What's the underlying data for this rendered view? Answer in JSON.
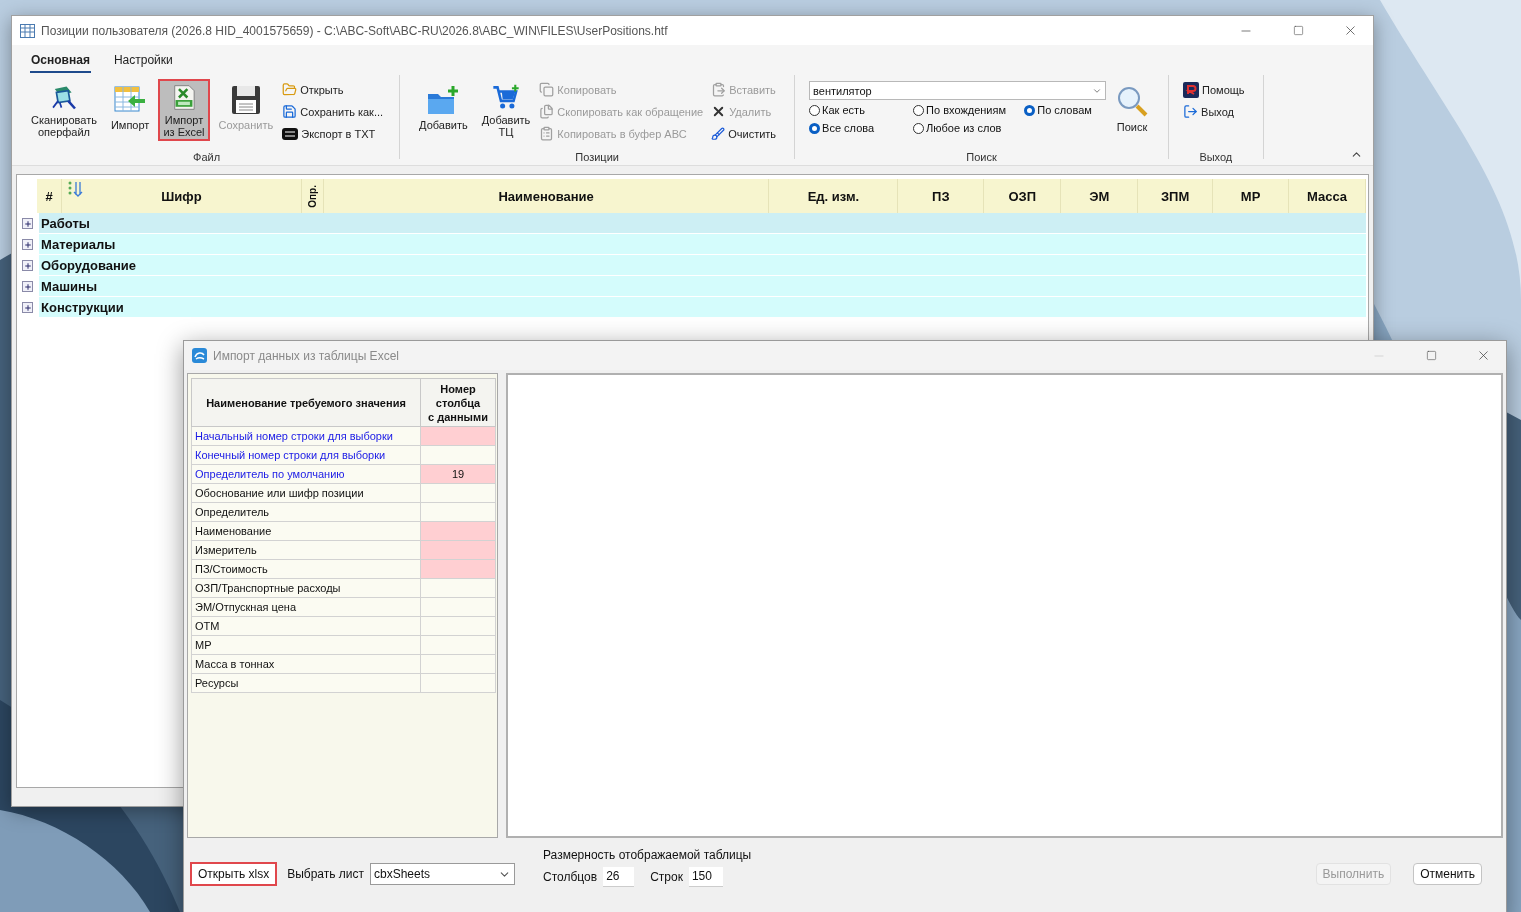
{
  "main_window": {
    "title": "Позиции пользователя (2026.8 HID_4001575659) - C:\\ABC-Soft\\ABC-RU\\2026.8\\ABC_WIN\\FILES\\UserPositions.htf",
    "ribbon_tabs": [
      {
        "label": "Основная",
        "selected": true
      },
      {
        "label": "Настройки",
        "selected": false
      }
    ],
    "ribbon_groups": [
      {
        "label": "Файл",
        "items": [
          {
            "kind": "large",
            "label": "Сканировать\nоперфайл",
            "disabled": false,
            "highlighted": false
          },
          {
            "kind": "large",
            "label": "Импорт",
            "disabled": false,
            "highlighted": false
          },
          {
            "kind": "large",
            "label": "Импорт\nиз Excel",
            "disabled": false,
            "highlighted": true
          },
          {
            "kind": "large",
            "label": "Сохранить",
            "disabled": true,
            "highlighted": false
          },
          {
            "kind": "column",
            "items": [
              {
                "label": "Открыть",
                "disabled": false
              },
              {
                "label": "Сохранить как...",
                "disabled": false
              },
              {
                "label": "Экспорт в TXT",
                "disabled": false
              }
            ]
          }
        ]
      },
      {
        "label": "Позиции",
        "items": [
          {
            "kind": "large",
            "label": "Добавить",
            "disabled": false,
            "highlighted": false
          },
          {
            "kind": "large",
            "label": "Добавить\nТЦ",
            "disabled": false,
            "highlighted": false
          },
          {
            "kind": "column",
            "items": [
              {
                "label": "Копировать",
                "disabled": true
              },
              {
                "label": "Скопировать как обращение",
                "disabled": true
              },
              {
                "label": "Копировать в буфер АВС",
                "disabled": true
              }
            ]
          },
          {
            "kind": "column",
            "items": [
              {
                "label": "Вставить",
                "disabled": true
              },
              {
                "label": "Удалить",
                "disabled": true
              },
              {
                "label": "Очистить",
                "disabled": false
              }
            ]
          }
        ]
      },
      {
        "label": "Поиск",
        "items": [
          {
            "kind": "search",
            "value": "вентилятор",
            "radio_rows": [
              [
                {
                  "label": "Как есть",
                  "selected": false
                },
                {
                  "label": "По вхождениям",
                  "selected": false
                },
                {
                  "label": "По словам",
                  "selected": true
                }
              ],
              [
                {
                  "label": "Все слова",
                  "selected": true
                },
                {
                  "label": "Любое из слов",
                  "selected": false
                }
              ]
            ]
          },
          {
            "kind": "large",
            "label": "Поиск",
            "disabled": false,
            "highlighted": false
          }
        ]
      },
      {
        "label": "Выход",
        "items": [
          {
            "kind": "column",
            "items": [
              {
                "label": "Помощь",
                "disabled": false
              },
              {
                "label": "Выход",
                "disabled": false
              }
            ]
          }
        ]
      }
    ],
    "table": {
      "columns": [
        "#",
        "Шифр",
        "Опр.",
        "Наименование",
        "Ед. изм.",
        "ПЗ",
        "ОЗП",
        "ЭМ",
        "ЗПМ",
        "МР",
        "Масса"
      ],
      "rows": [
        {
          "label": "Работы",
          "expanded": false,
          "selected": true
        },
        {
          "label": "Материалы",
          "expanded": false,
          "selected": false
        },
        {
          "label": "Оборудование",
          "expanded": false,
          "selected": false
        },
        {
          "label": "Машины",
          "expanded": false,
          "selected": false
        },
        {
          "label": "Конструкции",
          "expanded": false,
          "selected": false
        }
      ]
    }
  },
  "import_dialog": {
    "title": "Импорт данных из таблицы Excel",
    "minimize_disabled": true,
    "mapping_table": {
      "columns": [
        "Наименование требуемого значения",
        "Номер\nстолбца\nс данными"
      ],
      "rows": [
        {
          "name": "Начальный номер строки для выборки",
          "kind": "setting",
          "required": true
        },
        {
          "name": "Конечный номер строки для выборки",
          "kind": "setting",
          "required": false
        },
        {
          "name": "Определитель по умолчанию",
          "kind": "setting",
          "required": true,
          "value": "19"
        },
        {
          "name": "Обоснование или шифр позиции",
          "kind": "field",
          "required": false
        },
        {
          "name": "Определитель",
          "kind": "field",
          "required": false
        },
        {
          "name": "Наименование",
          "kind": "field",
          "required": true
        },
        {
          "name": "Измеритель",
          "kind": "field",
          "required": true
        },
        {
          "name": "ПЗ/Стоимость",
          "kind": "field",
          "required": true
        },
        {
          "name": "ОЗП/Транспортные расходы",
          "kind": "field",
          "required": false
        },
        {
          "name": "ЭМ/Отпускная цена",
          "kind": "field",
          "required": false
        },
        {
          "name": "ОТМ",
          "kind": "field",
          "required": false
        },
        {
          "name": "МР",
          "kind": "field",
          "required": false
        },
        {
          "name": "Масса в тоннах",
          "kind": "field",
          "required": false
        },
        {
          "name": "Ресурсы",
          "kind": "field",
          "required": false
        }
      ]
    },
    "open_button": {
      "label": "Открыть xlsx",
      "highlighted": true
    },
    "sheet": {
      "label": "Выбрать лист",
      "value": "cbxSheets"
    },
    "dimensions": {
      "title": "Размерность отображаемой таблицы",
      "columns_label": "Столбцов",
      "columns_value": "26",
      "rows_label": "Строк",
      "rows_value": "150"
    },
    "buttons": [
      {
        "label": "Выполнить",
        "disabled": true
      },
      {
        "label": "Отменить",
        "disabled": false
      }
    ]
  }
}
